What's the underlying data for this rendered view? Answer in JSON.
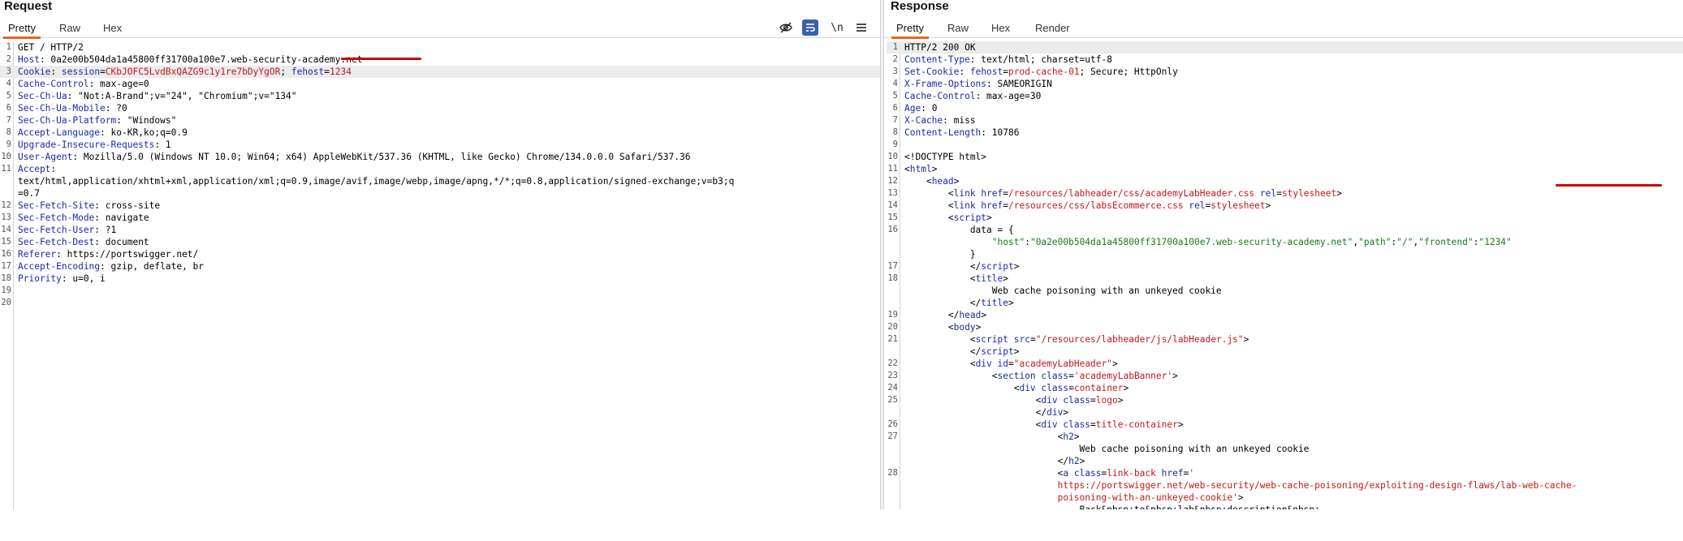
{
  "request": {
    "title": "Request",
    "tabs": [
      "Pretty",
      "Raw",
      "Hex"
    ],
    "toolbar": {
      "newline_label": "\\n"
    },
    "lines": [
      {
        "n": "1",
        "parts": [
          [
            "v",
            "GET / HTTP/2"
          ]
        ]
      },
      {
        "n": "2",
        "parts": [
          [
            "k",
            "Host"
          ],
          [
            "v",
            ": 0a2e00b504da1a45800ff31700a100e7.web-security-academy.net"
          ]
        ]
      },
      {
        "n": "3",
        "hl": true,
        "parts": [
          [
            "k",
            "Cookie"
          ],
          [
            "v",
            ": "
          ],
          [
            "k",
            "session"
          ],
          [
            "v",
            "="
          ],
          [
            "r",
            "CKbJOFC5LvdBxQAZG9c1y1re7bDyYgOR"
          ],
          [
            "v",
            "; "
          ],
          [
            "k",
            "fehost"
          ],
          [
            "v",
            "="
          ],
          [
            "r",
            "1234"
          ]
        ]
      },
      {
        "n": "4",
        "parts": [
          [
            "k",
            "Cache-Control"
          ],
          [
            "v",
            ": max-age=0"
          ]
        ]
      },
      {
        "n": "5",
        "parts": [
          [
            "k",
            "Sec-Ch-Ua"
          ],
          [
            "v",
            ": \"Not:A-Brand\";v=\"24\", \"Chromium\";v=\"134\""
          ]
        ]
      },
      {
        "n": "6",
        "parts": [
          [
            "k",
            "Sec-Ch-Ua-Mobile"
          ],
          [
            "v",
            ": ?0"
          ]
        ]
      },
      {
        "n": "7",
        "parts": [
          [
            "k",
            "Sec-Ch-Ua-Platform"
          ],
          [
            "v",
            ": \"Windows\""
          ]
        ]
      },
      {
        "n": "8",
        "parts": [
          [
            "k",
            "Accept-Language"
          ],
          [
            "v",
            ": ko-KR,ko;q=0.9"
          ]
        ]
      },
      {
        "n": "9",
        "parts": [
          [
            "k",
            "Upgrade-Insecure-Requests"
          ],
          [
            "v",
            ": 1"
          ]
        ]
      },
      {
        "n": "10",
        "parts": [
          [
            "k",
            "User-Agent"
          ],
          [
            "v",
            ": Mozilla/5.0 (Windows NT 10.0; Win64; x64) AppleWebKit/537.36 (KHTML, like Gecko) Chrome/134.0.0.0 Safari/537.36"
          ]
        ]
      },
      {
        "n": "11",
        "parts": [
          [
            "k",
            "Accept"
          ],
          [
            "v",
            ":"
          ]
        ]
      },
      {
        "n": "",
        "parts": [
          [
            "v",
            "text/html,application/xhtml+xml,application/xml;q=0.9,image/avif,image/webp,image/apng,*/*;q=0.8,application/signed-exchange;v=b3;q"
          ]
        ]
      },
      {
        "n": "",
        "parts": [
          [
            "v",
            "=0.7"
          ]
        ]
      },
      {
        "n": "12",
        "parts": [
          [
            "k",
            "Sec-Fetch-Site"
          ],
          [
            "v",
            ": cross-site"
          ]
        ]
      },
      {
        "n": "13",
        "parts": [
          [
            "k",
            "Sec-Fetch-Mode"
          ],
          [
            "v",
            ": navigate"
          ]
        ]
      },
      {
        "n": "14",
        "parts": [
          [
            "k",
            "Sec-Fetch-User"
          ],
          [
            "v",
            ": ?1"
          ]
        ]
      },
      {
        "n": "15",
        "parts": [
          [
            "k",
            "Sec-Fetch-Dest"
          ],
          [
            "v",
            ": document"
          ]
        ]
      },
      {
        "n": "16",
        "parts": [
          [
            "k",
            "Referer"
          ],
          [
            "v",
            ": https://portswigger.net/"
          ]
        ]
      },
      {
        "n": "17",
        "parts": [
          [
            "k",
            "Accept-Encoding"
          ],
          [
            "v",
            ": gzip, deflate, br"
          ]
        ]
      },
      {
        "n": "18",
        "parts": [
          [
            "k",
            "Priority"
          ],
          [
            "v",
            ": u=0, i"
          ]
        ]
      },
      {
        "n": "19",
        "parts": []
      },
      {
        "n": "20",
        "parts": []
      }
    ]
  },
  "response": {
    "title": "Response",
    "tabs": [
      "Pretty",
      "Raw",
      "Hex",
      "Render"
    ],
    "lines": [
      {
        "n": "1",
        "hl": true,
        "parts": [
          [
            "v",
            "HTTP/2 200 OK"
          ]
        ]
      },
      {
        "n": "2",
        "parts": [
          [
            "k",
            "Content-Type"
          ],
          [
            "v",
            ": text/html; charset=utf-8"
          ]
        ]
      },
      {
        "n": "3",
        "parts": [
          [
            "k",
            "Set-Cookie"
          ],
          [
            "v",
            ": "
          ],
          [
            "k",
            "fehost"
          ],
          [
            "v",
            "="
          ],
          [
            "r",
            "prod-cache-01"
          ],
          [
            "v",
            "; Secure; HttpOnly"
          ]
        ]
      },
      {
        "n": "4",
        "parts": [
          [
            "k",
            "X-Frame-Options"
          ],
          [
            "v",
            ": SAMEORIGIN"
          ]
        ]
      },
      {
        "n": "5",
        "parts": [
          [
            "k",
            "Cache-Control"
          ],
          [
            "v",
            ": max-age=30"
          ]
        ]
      },
      {
        "n": "6",
        "parts": [
          [
            "k",
            "Age"
          ],
          [
            "v",
            ": 0"
          ]
        ]
      },
      {
        "n": "7",
        "parts": [
          [
            "k",
            "X-Cache"
          ],
          [
            "v",
            ": miss"
          ]
        ]
      },
      {
        "n": "8",
        "parts": [
          [
            "k",
            "Content-Length"
          ],
          [
            "v",
            ": 10786"
          ]
        ]
      },
      {
        "n": "9",
        "parts": []
      },
      {
        "n": "10",
        "parts": [
          [
            "v",
            "<!DOCTYPE html>"
          ]
        ]
      },
      {
        "n": "11",
        "parts": [
          [
            "v",
            "<"
          ],
          [
            "tag",
            "html"
          ],
          [
            "v",
            ">"
          ]
        ]
      },
      {
        "n": "12",
        "parts": [
          [
            "v",
            "    <"
          ],
          [
            "tag",
            "head"
          ],
          [
            "v",
            ">"
          ]
        ]
      },
      {
        "n": "13",
        "parts": [
          [
            "v",
            "        <"
          ],
          [
            "tag",
            "link"
          ],
          [
            "v",
            " "
          ],
          [
            "attr",
            "href"
          ],
          [
            "v",
            "="
          ],
          [
            "aval",
            "/resources/labheader/css/academyLabHeader.css"
          ],
          [
            "v",
            " "
          ],
          [
            "attr",
            "rel"
          ],
          [
            "v",
            "="
          ],
          [
            "aval",
            "stylesheet"
          ],
          [
            "v",
            ">"
          ]
        ]
      },
      {
        "n": "14",
        "parts": [
          [
            "v",
            "        <"
          ],
          [
            "tag",
            "link"
          ],
          [
            "v",
            " "
          ],
          [
            "attr",
            "href"
          ],
          [
            "v",
            "="
          ],
          [
            "aval",
            "/resources/css/labsEcommerce.css"
          ],
          [
            "v",
            " "
          ],
          [
            "attr",
            "rel"
          ],
          [
            "v",
            "="
          ],
          [
            "aval",
            "stylesheet"
          ],
          [
            "v",
            ">"
          ]
        ]
      },
      {
        "n": "15",
        "parts": [
          [
            "v",
            "        <"
          ],
          [
            "tag",
            "script"
          ],
          [
            "v",
            ">"
          ]
        ]
      },
      {
        "n": "16",
        "parts": [
          [
            "v",
            "            data = {"
          ]
        ]
      },
      {
        "n": "",
        "parts": [
          [
            "v",
            "                "
          ],
          [
            "str",
            "\"host\""
          ],
          [
            "v",
            ":"
          ],
          [
            "str",
            "\"0a2e00b504da1a45800ff31700a100e7.web-security-academy.net\""
          ],
          [
            "v",
            ","
          ],
          [
            "str",
            "\"path\""
          ],
          [
            "v",
            ":"
          ],
          [
            "str",
            "\"/\""
          ],
          [
            "v",
            ","
          ],
          [
            "str",
            "\"frontend\""
          ],
          [
            "v",
            ":"
          ],
          [
            "str",
            "\"1234\""
          ]
        ]
      },
      {
        "n": "",
        "parts": [
          [
            "v",
            "            }"
          ]
        ]
      },
      {
        "n": "17",
        "parts": [
          [
            "v",
            "            </"
          ],
          [
            "tag",
            "script"
          ],
          [
            "v",
            ">"
          ]
        ]
      },
      {
        "n": "18",
        "parts": [
          [
            "v",
            "            <"
          ],
          [
            "tag",
            "title"
          ],
          [
            "v",
            ">"
          ]
        ]
      },
      {
        "n": "",
        "parts": [
          [
            "v",
            "                Web cache poisoning with an unkeyed cookie"
          ]
        ]
      },
      {
        "n": "",
        "parts": [
          [
            "v",
            "            </"
          ],
          [
            "tag",
            "title"
          ],
          [
            "v",
            ">"
          ]
        ]
      },
      {
        "n": "19",
        "parts": [
          [
            "v",
            "        </"
          ],
          [
            "tag",
            "head"
          ],
          [
            "v",
            ">"
          ]
        ]
      },
      {
        "n": "20",
        "parts": [
          [
            "v",
            "        <"
          ],
          [
            "tag",
            "body"
          ],
          [
            "v",
            ">"
          ]
        ]
      },
      {
        "n": "21",
        "parts": [
          [
            "v",
            "            <"
          ],
          [
            "tag",
            "script"
          ],
          [
            "v",
            " "
          ],
          [
            "attr",
            "src"
          ],
          [
            "v",
            "="
          ],
          [
            "aval",
            "\"/resources/labheader/js/labHeader.js\""
          ],
          [
            "v",
            ">"
          ]
        ]
      },
      {
        "n": "",
        "parts": [
          [
            "v",
            "            </"
          ],
          [
            "tag",
            "script"
          ],
          [
            "v",
            ">"
          ]
        ]
      },
      {
        "n": "22",
        "parts": [
          [
            "v",
            "            <"
          ],
          [
            "tag",
            "div"
          ],
          [
            "v",
            " "
          ],
          [
            "attr",
            "id"
          ],
          [
            "v",
            "="
          ],
          [
            "aval",
            "\"academyLabHeader\""
          ],
          [
            "v",
            ">"
          ]
        ]
      },
      {
        "n": "23",
        "parts": [
          [
            "v",
            "                <"
          ],
          [
            "tag",
            "section"
          ],
          [
            "v",
            " "
          ],
          [
            "attr",
            "class"
          ],
          [
            "v",
            "="
          ],
          [
            "aval",
            "'academyLabBanner'"
          ],
          [
            "v",
            ">"
          ]
        ]
      },
      {
        "n": "24",
        "parts": [
          [
            "v",
            "                    <"
          ],
          [
            "tag",
            "div"
          ],
          [
            "v",
            " "
          ],
          [
            "attr",
            "class"
          ],
          [
            "v",
            "="
          ],
          [
            "aval",
            "container"
          ],
          [
            "v",
            ">"
          ]
        ]
      },
      {
        "n": "25",
        "parts": [
          [
            "v",
            "                        <"
          ],
          [
            "tag",
            "div"
          ],
          [
            "v",
            " "
          ],
          [
            "attr",
            "class"
          ],
          [
            "v",
            "="
          ],
          [
            "aval",
            "logo"
          ],
          [
            "v",
            ">"
          ]
        ]
      },
      {
        "n": "",
        "parts": [
          [
            "v",
            "                        </"
          ],
          [
            "tag",
            "div"
          ],
          [
            "v",
            ">"
          ]
        ]
      },
      {
        "n": "26",
        "parts": [
          [
            "v",
            "                        <"
          ],
          [
            "tag",
            "div"
          ],
          [
            "v",
            " "
          ],
          [
            "attr",
            "class"
          ],
          [
            "v",
            "="
          ],
          [
            "aval",
            "title-container"
          ],
          [
            "v",
            ">"
          ]
        ]
      },
      {
        "n": "27",
        "parts": [
          [
            "v",
            "                            <"
          ],
          [
            "tag",
            "h2"
          ],
          [
            "v",
            ">"
          ]
        ]
      },
      {
        "n": "",
        "parts": [
          [
            "v",
            "                                Web cache poisoning with an unkeyed cookie"
          ]
        ]
      },
      {
        "n": "",
        "parts": [
          [
            "v",
            "                            </"
          ],
          [
            "tag",
            "h2"
          ],
          [
            "v",
            ">"
          ]
        ]
      },
      {
        "n": "28",
        "parts": [
          [
            "v",
            "                            <"
          ],
          [
            "tag",
            "a"
          ],
          [
            "v",
            " "
          ],
          [
            "attr",
            "class"
          ],
          [
            "v",
            "="
          ],
          [
            "aval",
            "link-back"
          ],
          [
            "v",
            " "
          ],
          [
            "attr",
            "href"
          ],
          [
            "v",
            "="
          ],
          [
            "aval",
            "'"
          ]
        ]
      },
      {
        "n": "",
        "parts": [
          [
            "aval",
            "                            https://portswigger.net/web-security/web-cache-poisoning/exploiting-design-flaws/lab-web-cache-"
          ]
        ]
      },
      {
        "n": "",
        "parts": [
          [
            "aval",
            "                            poisoning-with-an-unkeyed-cookie'"
          ],
          [
            "v",
            ">"
          ]
        ]
      },
      {
        "n": "",
        "parts": [
          [
            "v",
            "                                Back&nbsp;to&nbsp;lab&nbsp;description&nbsp;"
          ]
        ]
      }
    ]
  }
}
